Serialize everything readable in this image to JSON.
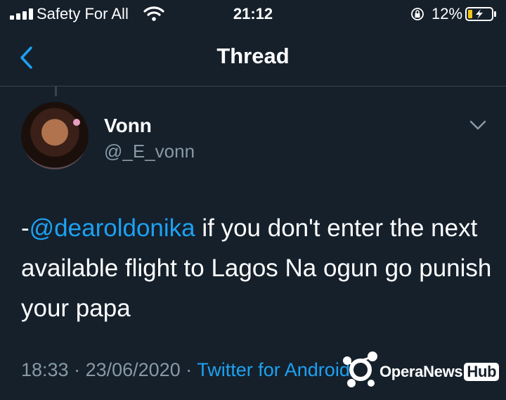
{
  "status": {
    "carrier": "Safety For All",
    "time": "21:12",
    "battery_percent": "12%",
    "icons": [
      "signal-bars-icon",
      "wifi-icon",
      "orientation-lock-icon",
      "battery-charging-icon"
    ]
  },
  "nav": {
    "back_icon": "chevron-left-icon",
    "title": "Thread"
  },
  "tweet": {
    "author_name": "Vonn",
    "author_handle": "@_E_vonn",
    "text_prefix": "-",
    "mention": "@dearoldonika",
    "text_body": " if you don't enter the next available flight to Lagos Na ogun go punish your papa",
    "time": "18:33",
    "separator": " · ",
    "date": "23/06/2020",
    "source": "Twitter for Android",
    "menu_icon": "chevron-down-icon"
  },
  "watermark": {
    "text_main": "OperaNews",
    "text_badge": "Hub"
  },
  "colors": {
    "background": "#15202b",
    "link": "#1da1f2",
    "secondary_text": "#8899a6",
    "divider": "#38444d"
  }
}
